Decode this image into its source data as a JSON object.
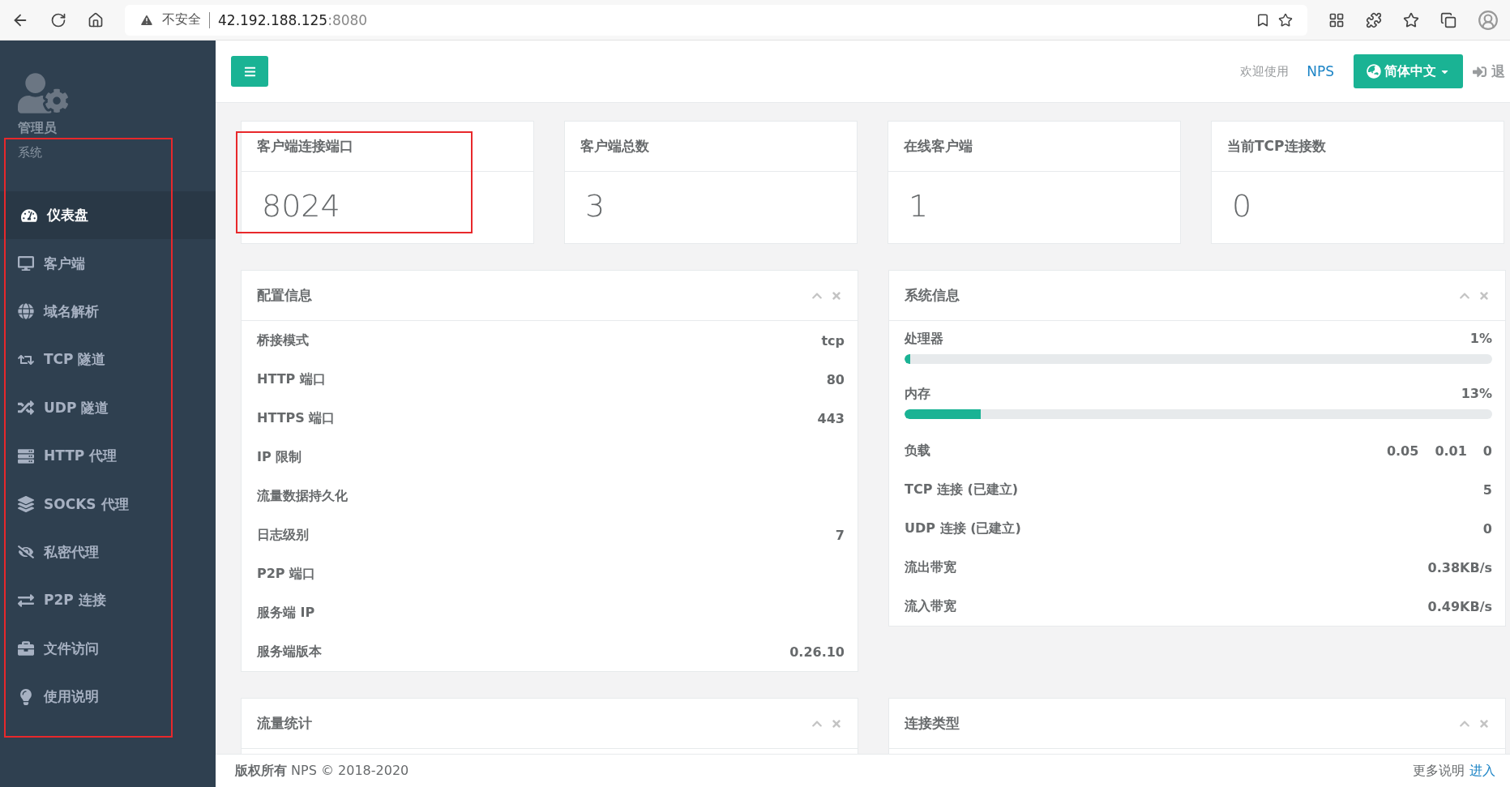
{
  "browser": {
    "security": "不安全",
    "host": "42.192.188.125",
    "port": ":8080"
  },
  "sidebar": {
    "highlighted": true,
    "user_label": "管理员",
    "section": "系统",
    "items": [
      {
        "label": "仪表盘",
        "selected": true
      },
      {
        "label": "客户端",
        "selected": false
      },
      {
        "label": "域名解析",
        "selected": false
      },
      {
        "label": "TCP 隧道",
        "selected": false
      },
      {
        "label": "UDP 隧道",
        "selected": false
      },
      {
        "label": "HTTP 代理",
        "selected": false
      },
      {
        "label": "SOCKS 代理",
        "selected": false
      },
      {
        "label": "私密代理",
        "selected": false
      },
      {
        "label": "P2P 连接",
        "selected": false
      },
      {
        "label": "文件访问",
        "selected": false
      },
      {
        "label": "使用说明",
        "selected": false
      }
    ]
  },
  "header": {
    "welcome": "欢迎使用",
    "brand": "NPS",
    "language": "简体中文",
    "logout": "退"
  },
  "stats": [
    {
      "title": "客户端连接端口",
      "value": "8024",
      "highlighted": true
    },
    {
      "title": "客户端总数",
      "value": "3",
      "highlighted": false
    },
    {
      "title": "在线客户端",
      "value": "1",
      "highlighted": false
    },
    {
      "title": "当前TCP连接数",
      "value": "0",
      "highlighted": false
    }
  ],
  "config_panel": {
    "title": "配置信息",
    "rows": [
      {
        "label": "桥接模式",
        "value": "tcp"
      },
      {
        "label": "HTTP 端口",
        "value": "80"
      },
      {
        "label": "HTTPS 端口",
        "value": "443"
      },
      {
        "label": "IP 限制"
      },
      {
        "label": "流量数据持久化"
      },
      {
        "label": "日志级别",
        "value": "7"
      },
      {
        "label": "P2P 端口"
      },
      {
        "label": "服务端 IP"
      },
      {
        "label": "服务端版本",
        "value": "0.26.10"
      }
    ]
  },
  "system_panel": {
    "title": "系统信息",
    "rows": [
      {
        "kind": "meter",
        "label": "处理器",
        "reading": "1%",
        "level": 0.01
      },
      {
        "kind": "meter",
        "label": "内存",
        "reading": "13%",
        "level": 0.13
      },
      {
        "kind": "values",
        "label": "负载",
        "values": [
          "0.05",
          "0.01",
          "0"
        ]
      },
      {
        "kind": "text",
        "label": "TCP 连接 (已建立)",
        "value": "5"
      },
      {
        "kind": "text",
        "label": "UDP 连接 (已建立)",
        "value": "0"
      },
      {
        "kind": "text",
        "label": "流出带宽",
        "value": "0.38KB/s"
      },
      {
        "kind": "text",
        "label": "流入带宽",
        "value": "0.49KB/s"
      }
    ]
  },
  "bottom_panels": [
    {
      "title": "流量统计"
    },
    {
      "title": "连接类型"
    }
  ],
  "footer": {
    "copyright_label": "版权所有",
    "copyright": "NPS © 2018-2020",
    "more": "更多说明",
    "link": "进入"
  }
}
